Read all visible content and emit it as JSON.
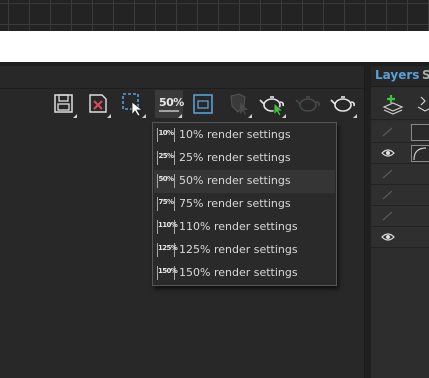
{
  "layers_panel": {
    "tab_layers": "Layers",
    "tab_partial": "S"
  },
  "toolbar": {
    "save_icon": "save-icon",
    "delete_icon": "delete-file-icon",
    "region_icon": "render-region-icon",
    "scale_button_label": "50%",
    "frame_icon": "render-frame-icon",
    "accent_color": "#5aa0d8",
    "render_play_color": "#3ec43e"
  },
  "render_scale_menu": {
    "items": [
      {
        "icon": "10%",
        "label": "10% render settings"
      },
      {
        "icon": "25%",
        "label": "25% render settings"
      },
      {
        "icon": "50%",
        "label": "50% render settings"
      },
      {
        "icon": "75%",
        "label": "75% render settings"
      },
      {
        "icon": "110%",
        "label": "110% render settings"
      },
      {
        "icon": "125%",
        "label": "125% render settings"
      },
      {
        "icon": "150%",
        "label": "150% render settings"
      }
    ],
    "highlighted_index": 2
  }
}
